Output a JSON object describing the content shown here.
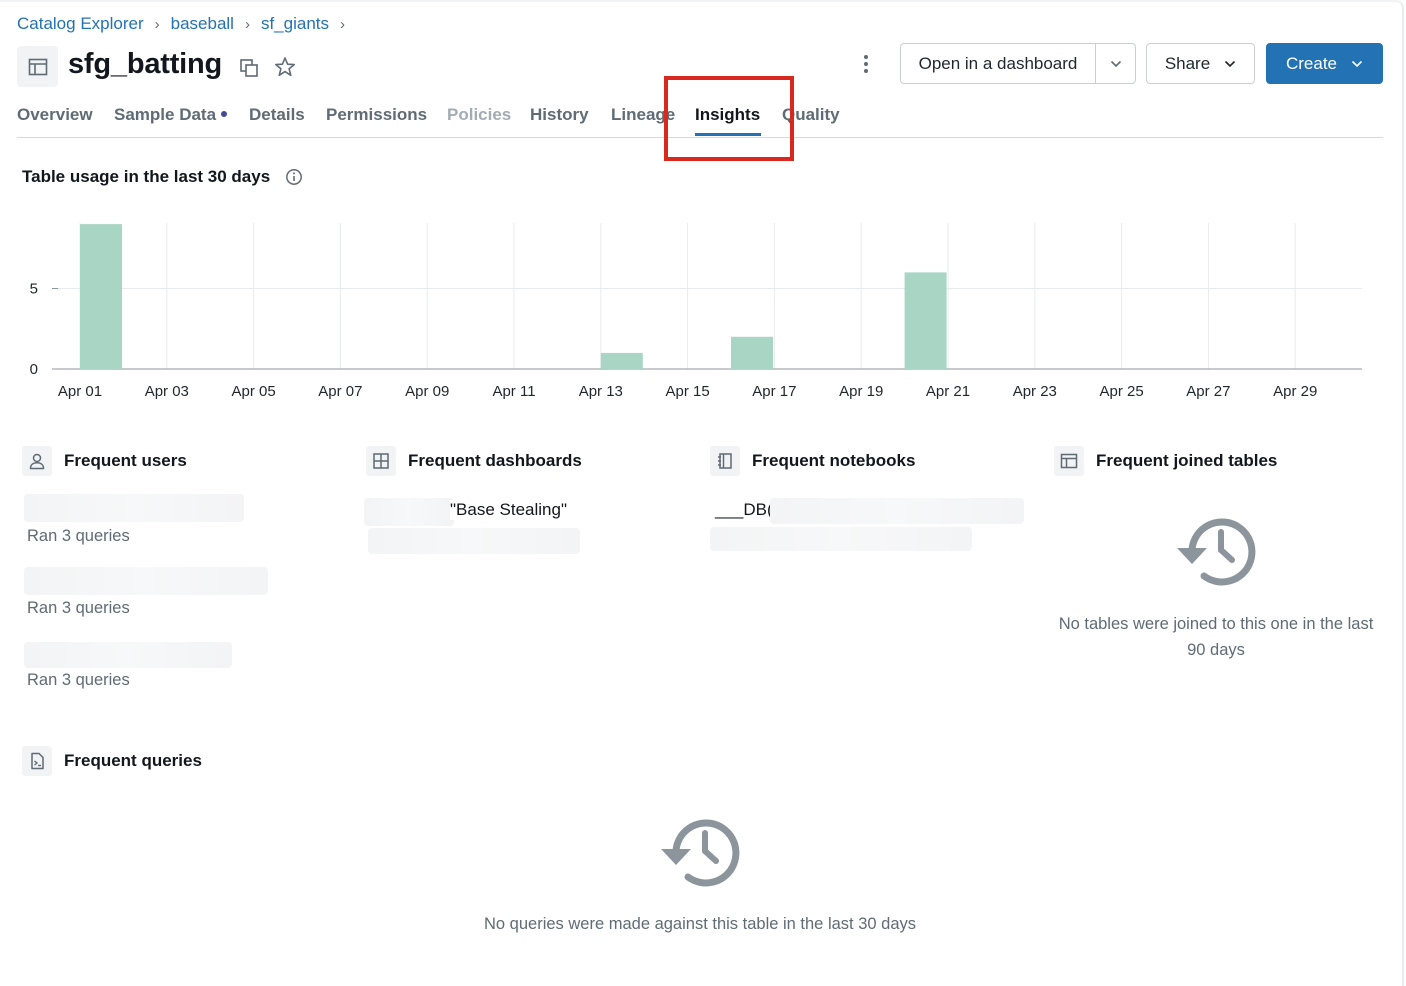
{
  "breadcrumb": {
    "items": [
      "Catalog Explorer",
      "baseball",
      "sf_giants"
    ],
    "separator": "›"
  },
  "header": {
    "title": "sfg_batting",
    "open_dashboard_label": "Open in a dashboard",
    "share_label": "Share",
    "create_label": "Create"
  },
  "tabs": [
    {
      "label": "Overview",
      "state": "normal"
    },
    {
      "label": "Sample Data",
      "state": "normal",
      "dot": true
    },
    {
      "label": "Details",
      "state": "normal"
    },
    {
      "label": "Permissions",
      "state": "normal"
    },
    {
      "label": "Policies",
      "state": "disabled"
    },
    {
      "label": "History",
      "state": "normal"
    },
    {
      "label": "Lineage",
      "state": "normal"
    },
    {
      "label": "Insights",
      "state": "active"
    },
    {
      "label": "Quality",
      "state": "normal"
    }
  ],
  "usage_section": {
    "title": "Table usage in the last 30 days"
  },
  "chart_data": {
    "type": "bar",
    "x": [
      "Apr 01",
      "Apr 02",
      "Apr 03",
      "Apr 04",
      "Apr 05",
      "Apr 06",
      "Apr 07",
      "Apr 08",
      "Apr 09",
      "Apr 10",
      "Apr 11",
      "Apr 12",
      "Apr 13",
      "Apr 14",
      "Apr 15",
      "Apr 16",
      "Apr 17",
      "Apr 18",
      "Apr 19",
      "Apr 20",
      "Apr 21",
      "Apr 22",
      "Apr 23",
      "Apr 24",
      "Apr 25",
      "Apr 26",
      "Apr 27",
      "Apr 28",
      "Apr 29",
      "Apr 30"
    ],
    "values": [
      9,
      0,
      0,
      0,
      0,
      0,
      0,
      0,
      0,
      0,
      0,
      0,
      1,
      0,
      0,
      2,
      0,
      0,
      0,
      6,
      0,
      0,
      0,
      0,
      0,
      0,
      0,
      0,
      0,
      0
    ],
    "x_tick_labels": [
      "Apr 01",
      "Apr 03",
      "Apr 05",
      "Apr 07",
      "Apr 09",
      "Apr 11",
      "Apr 13",
      "Apr 15",
      "Apr 17",
      "Apr 19",
      "Apr 21",
      "Apr 23",
      "Apr 25",
      "Apr 27",
      "Apr 29"
    ],
    "y_tick_labels": [
      "0",
      "5"
    ],
    "y_ticks": [
      0,
      5
    ],
    "ylim": [
      0,
      9
    ],
    "grid": true,
    "bar_color": "#a8d5c4"
  },
  "frequent_users": {
    "title": "Frequent users",
    "items": [
      {
        "meta": "Ran 3 queries"
      },
      {
        "meta": "Ran 3 queries"
      },
      {
        "meta": "Ran 3 queries"
      }
    ]
  },
  "frequent_dashboards": {
    "title": "Frequent dashboards",
    "items": [
      {
        "name": "\"Base Stealing\""
      }
    ]
  },
  "frequent_notebooks": {
    "title": "Frequent notebooks",
    "items": [
      {
        "name": "___DB("
      }
    ]
  },
  "frequent_joined_tables": {
    "title": "Frequent joined tables",
    "empty_text": "No tables were joined to this one in the last 90 days"
  },
  "frequent_queries": {
    "title": "Frequent queries",
    "empty_text": "No queries were made against this table in the last 30 days"
  },
  "colors": {
    "accent": "#2272b4",
    "highlight": "#d9281e",
    "bar": "#a8d5c4"
  }
}
